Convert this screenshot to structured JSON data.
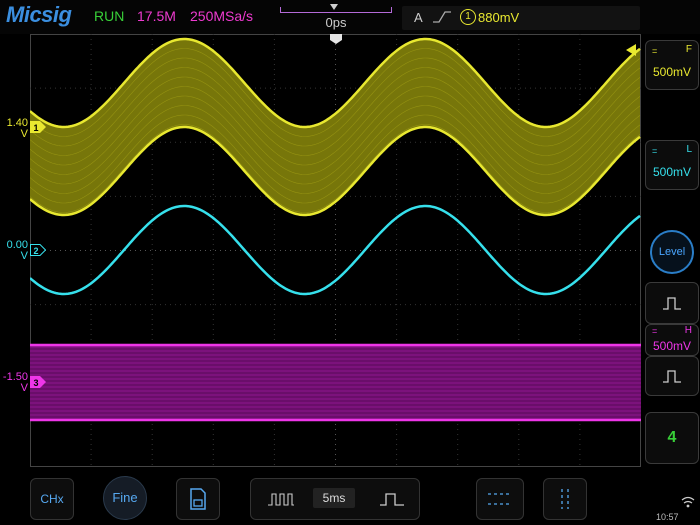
{
  "app": {
    "logo": "Micsig"
  },
  "status": {
    "run_state": "RUN",
    "memory_depth": "17.5M",
    "sample_rate": "250MSa/s",
    "horizontal_position": "0ps",
    "trigger_mode": "A",
    "trigger_source": "1",
    "trigger_level": "880mV"
  },
  "channels": [
    {
      "id": "1",
      "offset_value": "1.40",
      "offset_unit": "V",
      "color": "#e8e830"
    },
    {
      "id": "2",
      "offset_value": "0.00",
      "offset_unit": "V",
      "color": "#36e0ec"
    },
    {
      "id": "3",
      "offset_value": "-1.50",
      "offset_unit": "V",
      "color": "#ee36e8"
    }
  ],
  "right_panel": {
    "ch1_button": {
      "coupling": "=",
      "letter": "F",
      "scale": "500mV"
    },
    "ch2_button": {
      "coupling": "=",
      "letter": "L",
      "scale": "500mV"
    },
    "ch3_button": {
      "coupling": "=",
      "letter": "H",
      "scale": "500mV"
    },
    "level_label": "Level",
    "page_number": "4"
  },
  "bottom_bar": {
    "chx_label": "CHx",
    "fine_label": "Fine",
    "timebase": "5ms"
  },
  "clock": "10:57",
  "icons": [
    "trigger-slope-rising-icon",
    "save-icon",
    "pulse-narrow-icon",
    "pulse-wide-icon",
    "cursor-horizontal-icon",
    "cursor-vertical-icon",
    "wifi-icon",
    "trigger-arrow-icon"
  ]
}
